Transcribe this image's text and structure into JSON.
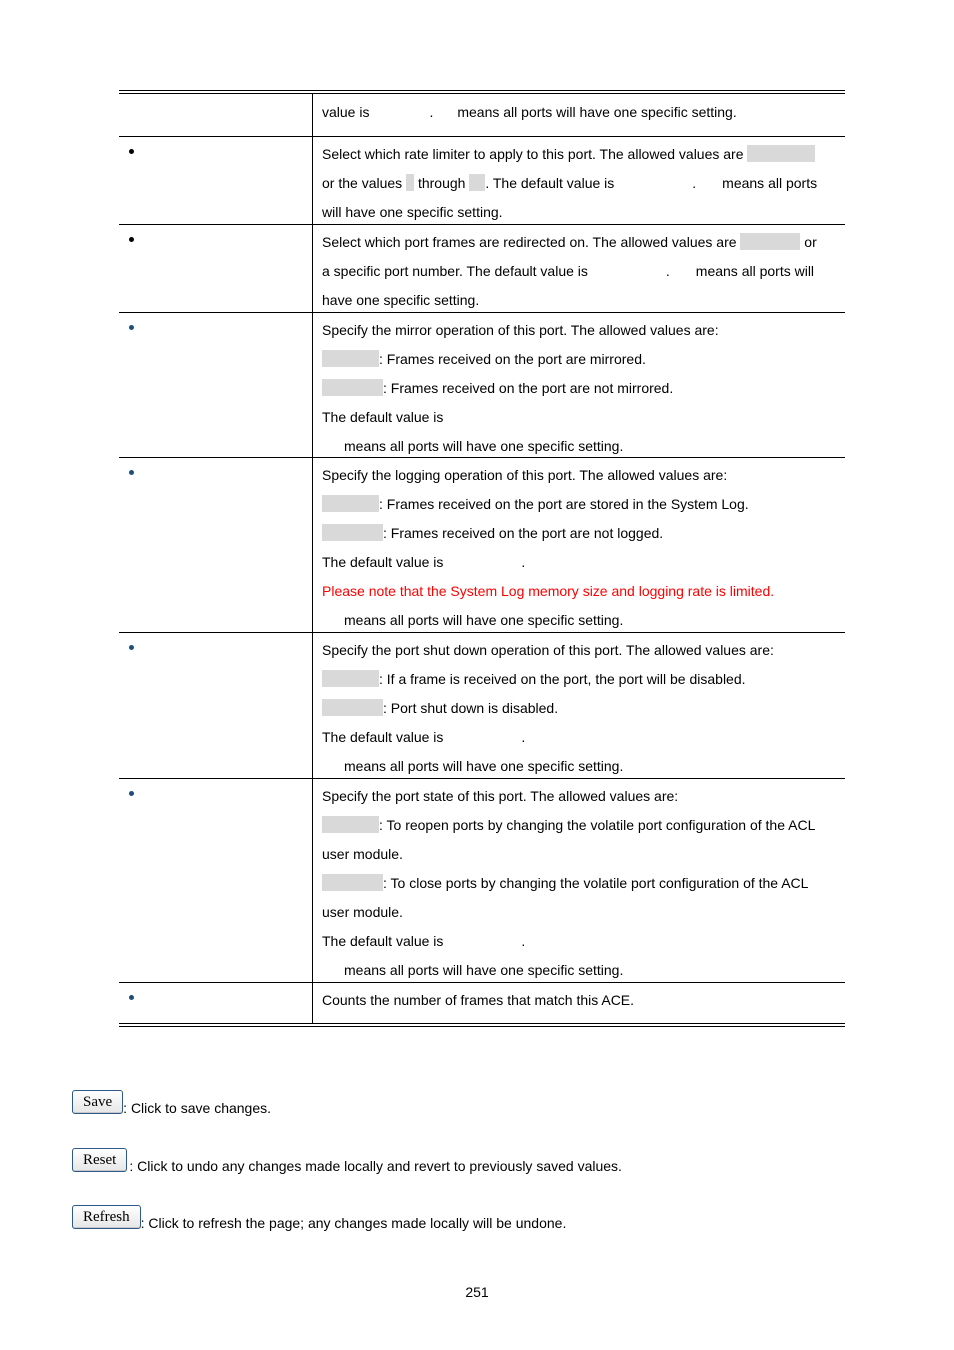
{
  "table": {
    "rows": [
      {
        "bullet_color": "none",
        "lines": [
          "value is",
          ".",
          "means all ports will have one specific setting."
        ]
      },
      {
        "bullet_color": "#000000",
        "lines": [
          "Select which rate limiter to apply to this port. The allowed values are",
          "or the values",
          "through",
          ". The default value is",
          ".",
          "means all ports",
          "will have one specific setting."
        ]
      },
      {
        "bullet_color": "#000000",
        "lines": [
          "Select which port frames are redirected on. The allowed values are",
          "or",
          "a specific port number. The default value is",
          ".",
          "means all ports will",
          "have one specific setting."
        ]
      },
      {
        "bullet_color": "#1f4e79",
        "lines": [
          "Specify the mirror operation of this port. The allowed values are:",
          ": Frames received on the port are mirrored.",
          ": Frames received on the port are not mirrored.",
          "The default value is",
          "means all ports will have one specific setting."
        ]
      },
      {
        "bullet_color": "#1f4e79",
        "lines": [
          "Specify the logging operation of this port. The allowed values are:",
          ": Frames received on the port are stored in the System Log.",
          ": Frames received on the port are not logged.",
          "The default value is",
          ".",
          "Please note that the System Log memory size and logging rate is limited.",
          "means all ports will have one specific setting."
        ]
      },
      {
        "bullet_color": "#1f4e79",
        "lines": [
          "Specify the port shut down operation of this port. The allowed values are:",
          ": If a frame is received on the port, the port will be disabled.",
          ": Port shut down is disabled.",
          "The default value is",
          ".",
          "means all ports will have one specific setting."
        ]
      },
      {
        "bullet_color": "#1f4e79",
        "lines": [
          "Specify the port state of this port. The allowed values are:",
          ": To reopen ports by changing the volatile port configuration of the ACL",
          "user module.",
          ": To close ports by changing the volatile port configuration of the ACL",
          "user module.",
          "The default value is",
          ".",
          "means all ports will have one specific setting."
        ]
      },
      {
        "bullet_color": "#1f4e79",
        "lines": [
          "Counts the number of frames that match this ACE."
        ]
      }
    ]
  },
  "buttons": [
    {
      "label": "Save",
      "description": ": Click to save changes."
    },
    {
      "label": "Reset",
      "description": ": Click to undo any changes made locally and revert to previously saved values."
    },
    {
      "label": "Refresh",
      "description": ": Click to refresh the page; any changes made locally will be undone."
    }
  ],
  "page_number": "251",
  "colors": {
    "warning_text": "#ff0000",
    "placeholder_highlight": "#d9d9d9",
    "bullet_blue": "#1f4e79"
  }
}
